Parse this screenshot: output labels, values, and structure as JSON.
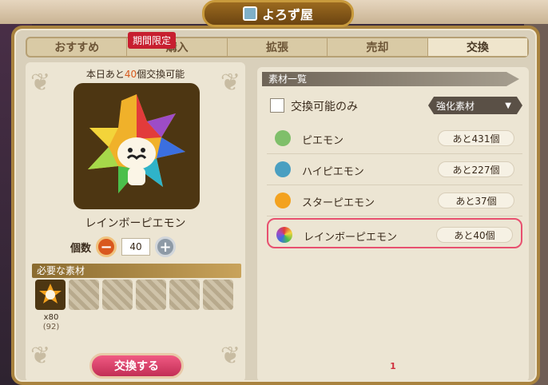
{
  "window": {
    "title": "よろず屋"
  },
  "tabs": [
    {
      "label": "おすすめ"
    },
    {
      "label": "購入"
    },
    {
      "label": "拡張"
    },
    {
      "label": "売却"
    },
    {
      "label": "交換"
    }
  ],
  "limited_badge": "期間限定",
  "left": {
    "quota_prefix": "本日あと",
    "quota_num": "40",
    "quota_suffix": "個交換可能",
    "item_name": "レインボーピエモン",
    "qty_label": "個数",
    "qty_value": "40",
    "minus": "−",
    "plus": "+",
    "required_header": "必要な素材",
    "req_count": "x80",
    "req_have": "(92)",
    "exchange_button": "交換する"
  },
  "right": {
    "header": "素材一覧",
    "filter_label": "交換可能のみ",
    "select_value": "強化素材",
    "rows": [
      {
        "name": "ピエモン",
        "count": "あと431個",
        "color": "#7fbf6a"
      },
      {
        "name": "ハイピエモン",
        "count": "あと227個",
        "color": "#4a9fc1"
      },
      {
        "name": "スターピエモン",
        "count": "あと37個",
        "color": "#f3a21f"
      },
      {
        "name": "レインボーピエモン",
        "count": "あと40個",
        "color": "#c84fb6"
      }
    ],
    "page": "1"
  },
  "colors": {
    "accent": "#e8506f",
    "frame": "#a9833f"
  }
}
